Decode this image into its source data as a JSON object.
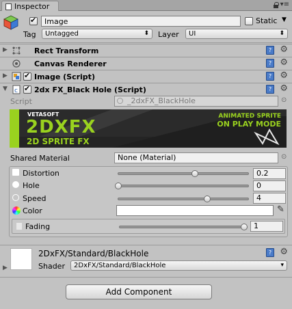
{
  "window": {
    "tab_label": "Inspector"
  },
  "gameobject": {
    "name": "Image",
    "active": true,
    "static_label": "Static",
    "static_checked": false,
    "tag_label": "Tag",
    "tag_value": "Untagged",
    "layer_label": "Layer",
    "layer_value": "UI"
  },
  "components": [
    {
      "title": "Rect Transform",
      "has_checkbox": false,
      "icon": "rect-transform-icon"
    },
    {
      "title": "Canvas Renderer",
      "has_checkbox": false,
      "icon": "canvas-renderer-icon"
    },
    {
      "title": "Image (Script)",
      "has_checkbox": true,
      "checked": true,
      "icon": "image-script-icon"
    },
    {
      "title": "2dx FX_Black Hole (Script)",
      "has_checkbox": true,
      "checked": true,
      "icon": "script-icon"
    }
  ],
  "script_field": {
    "label": "Script",
    "value": "_2dxFX_BlackHole"
  },
  "banner": {
    "brand": "VETASOFT",
    "title": "2DXFX",
    "subtitle": "2D SPRITE FX",
    "tagline_1": "ANIMATED SPRITE",
    "tagline_2": "ON PLAY MODE"
  },
  "properties": {
    "shared_material_label": "Shared Material",
    "shared_material_value": "None (Material)",
    "distortion": {
      "label": "Distortion",
      "value": "0.2",
      "fraction": 0.2
    },
    "hole": {
      "label": "Hole",
      "value": "0",
      "fraction": 0.0
    },
    "speed": {
      "label": "Speed",
      "value": "4",
      "fraction": 0.4
    },
    "color": {
      "label": "Color",
      "swatch": "#ffffff"
    },
    "fading": {
      "label": "Fading",
      "value": "1",
      "fraction": 1.0
    }
  },
  "material": {
    "name": "2DxFX/Standard/BlackHole",
    "shader_label": "Shader",
    "shader_value": "2DxFX/Standard/BlackHole"
  },
  "add_component_label": "Add Component",
  "colors": {
    "banner_green": "#9ad21f",
    "banner_dark": "#2a2a2a"
  }
}
